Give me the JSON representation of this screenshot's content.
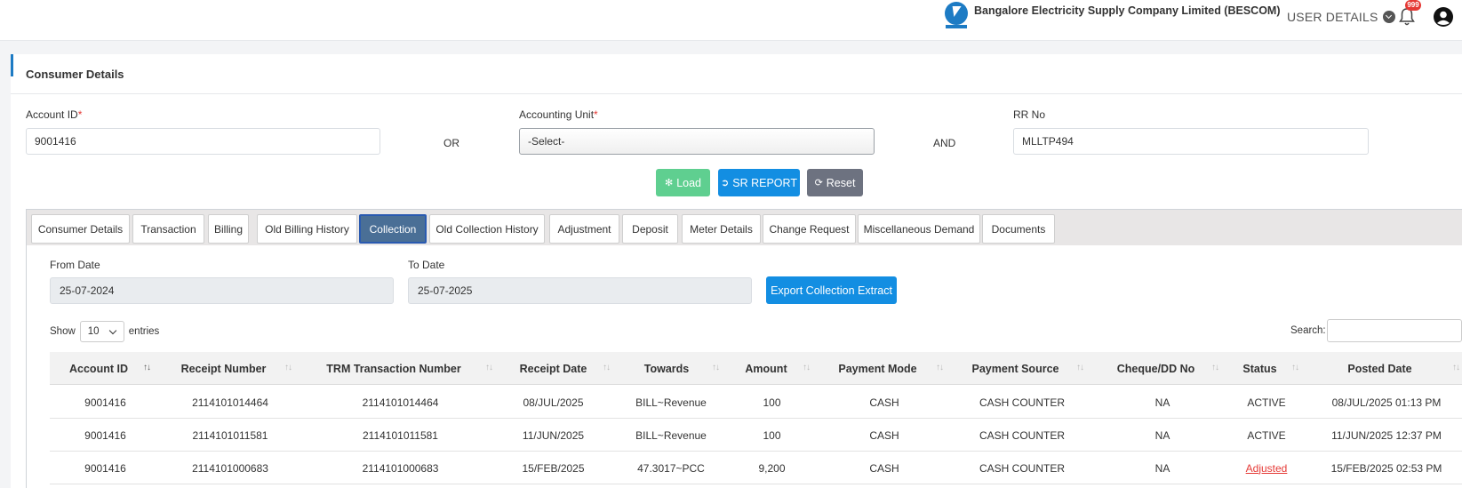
{
  "header": {
    "company_name": "Bangalore Electricity Supply Company Limited (BESCOM)",
    "user_details_label": "USER DETAILS",
    "notification_count": "999",
    "logo_icon": "bescom-logo-icon",
    "bell_icon": "bell-icon",
    "avatar_icon": "user-circle-icon"
  },
  "section": {
    "title": "Consumer Details"
  },
  "form": {
    "account_id_label": "Account ID",
    "account_id_value": "9001416",
    "or_label": "OR",
    "accounting_unit_label": "Accounting Unit",
    "accounting_unit_value": "-Select-",
    "and_label": "AND",
    "rr_no_label": "RR No",
    "rr_no_value": "MLLTP494",
    "required_mark": "*",
    "load_label": "Load",
    "sr_report_label": "SR REPORT",
    "reset_label": "Reset"
  },
  "tabs": [
    {
      "label": "Consumer Details"
    },
    {
      "label": "Transaction"
    },
    {
      "label": "Billing"
    },
    {
      "label": "Old Billing History"
    },
    {
      "label": "Collection"
    },
    {
      "label": "Old Collection History"
    },
    {
      "label": "Adjustment"
    },
    {
      "label": "Deposit"
    },
    {
      "label": "Meter Details"
    },
    {
      "label": "Change Request"
    },
    {
      "label": "Miscellaneous Demand"
    },
    {
      "label": "Documents"
    }
  ],
  "active_tab": "Collection",
  "collection": {
    "from_date_label": "From Date",
    "from_date_value": "25-07-2024",
    "to_date_label": "To Date",
    "to_date_value": "25-07-2025",
    "export_label": "Export Collection Extract",
    "show_label": "Show",
    "page_length": "10",
    "entries_label": "entries",
    "search_label": "Search:",
    "search_value": ""
  },
  "table": {
    "columns": [
      "Account ID",
      "Receipt Number",
      "TRM Transaction Number",
      "Receipt Date",
      "Towards",
      "Amount",
      "Payment Mode",
      "Payment Source",
      "Cheque/DD No",
      "Status",
      "Posted Date"
    ],
    "sort_indicator": "↑↓",
    "rows": [
      [
        "9001416",
        "2114101014464",
        "2114101014464",
        "08/JUL/2025",
        "BILL~Revenue",
        "100",
        "CASH",
        "CASH COUNTER",
        "NA",
        "ACTIVE",
        "08/JUL/2025 01:13 PM"
      ],
      [
        "9001416",
        "2114101011581",
        "2114101011581",
        "11/JUN/2025",
        "BILL~Revenue",
        "100",
        "CASH",
        "CASH COUNTER",
        "NA",
        "ACTIVE",
        "11/JUN/2025 12:37 PM"
      ],
      [
        "9001416",
        "2114101000683",
        "2114101000683",
        "15/FEB/2025",
        "47.3017~PCC",
        "9,200",
        "CASH",
        "CASH COUNTER",
        "NA",
        "Adjusted",
        "15/FEB/2025 02:53 PM"
      ]
    ]
  },
  "colors": {
    "primary": "#138ee2",
    "load": "#5fcf90",
    "reset": "#6d7280",
    "active_tab": "#4a6f96",
    "adjusted": "#e53935"
  }
}
